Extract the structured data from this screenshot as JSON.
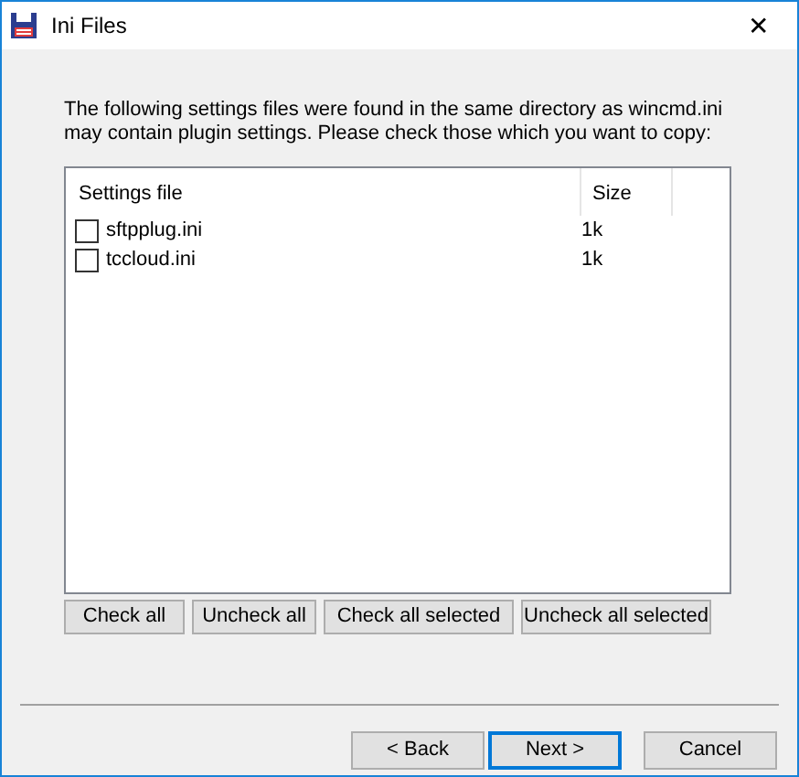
{
  "window": {
    "title": "Ini Files",
    "close": "✕"
  },
  "intro": "The following settings files were found in the same directory as wincmd.ini may contain plugin settings. Please check those which you want to copy:",
  "table": {
    "columns": [
      "Settings file",
      "Size"
    ],
    "rows": [
      {
        "name": "sftpplug.ini",
        "size": "1k",
        "checked": false
      },
      {
        "name": "tccloud.ini",
        "size": "1k",
        "checked": false
      }
    ]
  },
  "list_buttons": [
    "Check all",
    "Uncheck all",
    "Check all selected",
    "Uncheck all selected"
  ],
  "nav_buttons": [
    {
      "label": "< Back",
      "default": false
    },
    {
      "label": "Next >",
      "default": true
    },
    {
      "label": "Cancel",
      "default": false
    }
  ]
}
